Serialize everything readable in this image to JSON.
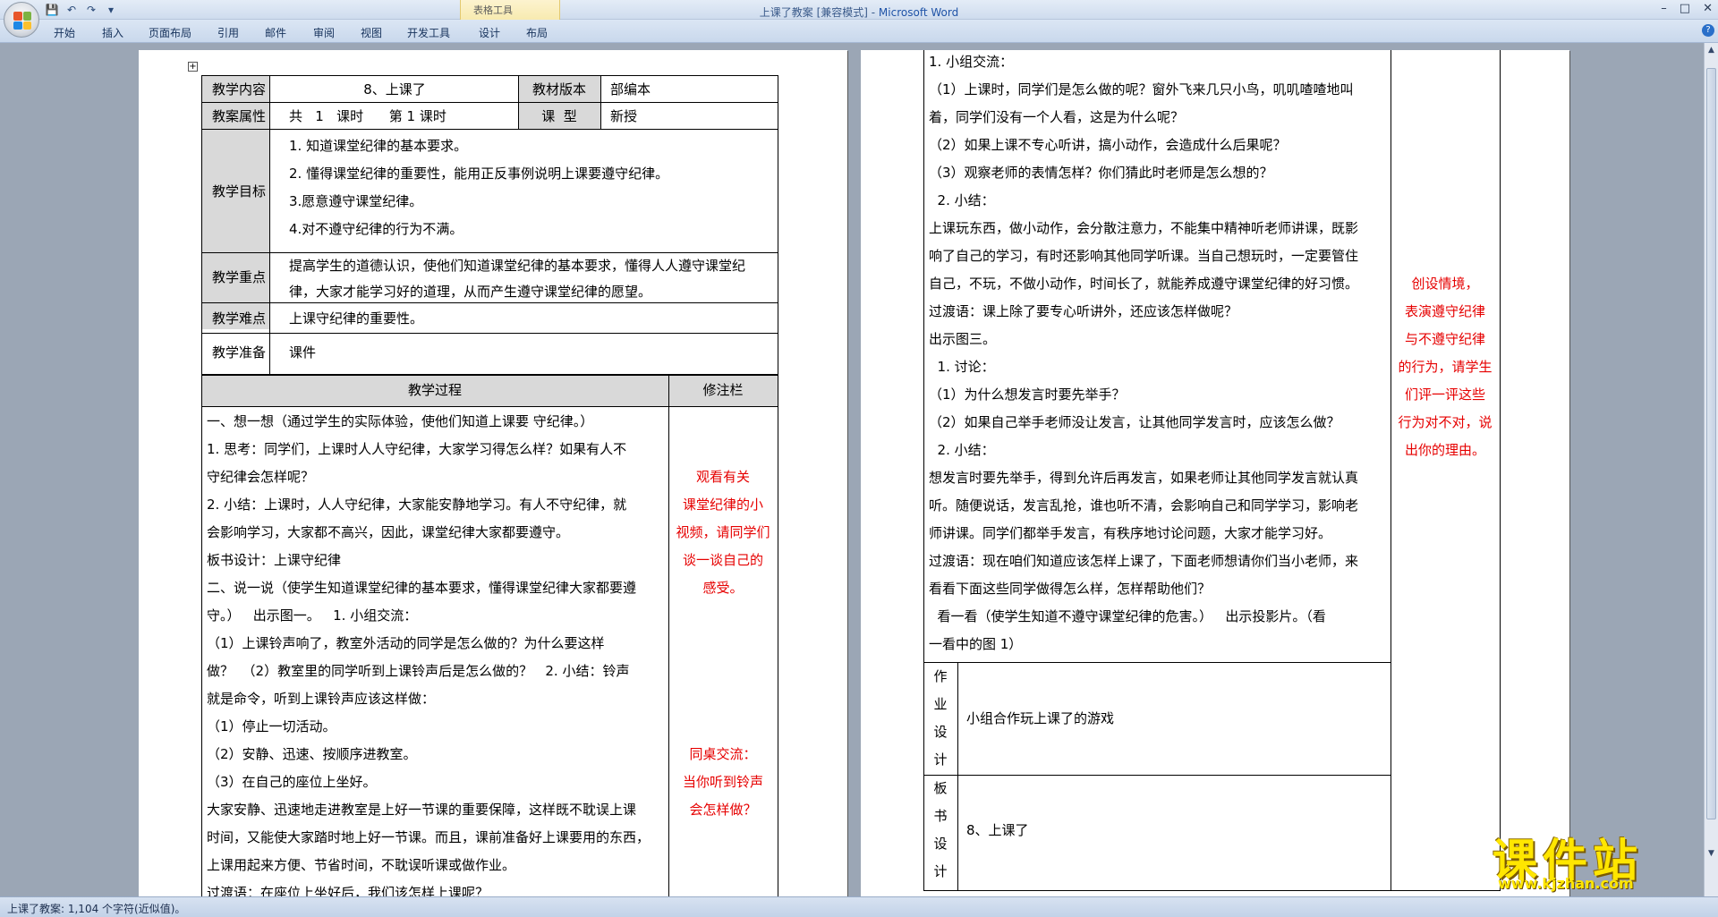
{
  "window": {
    "title_doc": "上课了教案 [兼容模式] - ",
    "title_app": "Microsoft Word",
    "contextual_group": "表格工具"
  },
  "ribbon": {
    "tabs": [
      "开始",
      "插入",
      "页面布局",
      "引用",
      "邮件",
      "审阅",
      "视图",
      "开发工具",
      "设计",
      "布局"
    ]
  },
  "status": {
    "text": "上课了教案: 1,104 个字符(近似值)。"
  },
  "watermark": {
    "main": "课件站",
    "url": "www.kjzhan.com"
  },
  "left": {
    "r1": {
      "lbl1": "教学内容",
      "val1": "8、上课了",
      "lbl2": "教材版本",
      "val2": "部编本"
    },
    "r2": {
      "lbl1": "教案属性",
      "val1": "共   1   课时      第 1 课时",
      "lbl2": "课  型",
      "val2": "新授"
    },
    "goals": {
      "label": "教学目标",
      "items": [
        "1. 知道课堂纪律的基本要求。",
        "2. 懂得课堂纪律的重要性，能用正反事例说明上课要遵守纪律。",
        "3.愿意遵守课堂纪律。",
        "4.对不遵守纪律的行为不满。"
      ]
    },
    "key": {
      "label": "教学重点",
      "lines": [
        "提高学生的道德认识，使他们知道课堂纪律的基本要求，懂得人人遵守课堂纪",
        "律，大家才能学习好的道理，从而产生遵守课堂纪律的愿望。"
      ]
    },
    "difficulty": {
      "label": "教学难点",
      "text": "上课守纪律的重要性。"
    },
    "prep": {
      "label": "教学准备",
      "text": "课件"
    },
    "process_header": {
      "main": "教学过程",
      "notes": "修注栏"
    },
    "process_lines": [
      "一、想一想（通过学生的实际体验，使他们知道上课要   守纪律。）",
      "1. 思考：同学们，上课时人人守纪律，大家学习得怎么样？如果有人不",
      "守纪律会怎样呢？",
      "2. 小结：上课时，人人守纪律，大家能安静地学习。有人不守纪律，就",
      "会影响学习，大家都不高兴，因此，课堂纪律大家都要遵守。",
      "板书设计：上课守纪律",
      "二、说一说（使学生知道课堂纪律的基本要求，懂得课堂纪律大家都要遵",
      "守。）   出示图一。   1. 小组交流：",
      "（1）上课铃声响了，教室外活动的同学是怎么做的？为什么要这样",
      "做？  （2）教室里的同学听到上课铃声后是怎么做的？   2. 小结：铃声",
      "就是命令，听到上课铃声应该这样做：",
      "（1）停止一切活动。",
      "（2）安静、迅速、按顺序进教室。",
      "（3）在自己的座位上坐好。",
      "大家安静、迅速地走进教室是上好一节课的重要保障，这样既不耽误上课",
      "时间，又能使大家踏时地上好一节课。而且，课前准备好上课要用的东西，",
      "上课用起来方便、节省时间，不耽误听课或做作业。",
      "过渡语：在座位上坐好后，我们该怎样上课呢？"
    ],
    "note1": [
      "观看有关",
      "课堂纪律的小",
      "视频，请同学们",
      "谈一谈自己的",
      "感受。"
    ],
    "note2": [
      "同桌交流：",
      "当你听到铃声",
      "会怎样做？"
    ]
  },
  "right": {
    "lines": [
      "1. 小组交流：",
      "（1）上课时，同学们是怎么做的呢？窗外飞来几只小鸟，叽叽喳喳地叫",
      "着，同学们没有一个人看，这是为什么呢？",
      "（2）如果上课不专心听讲，搞小动作，会造成什么后果呢？",
      "（3）观察老师的表情怎样？你们猜此时老师是怎么想的？",
      "  2. 小结：",
      "上课玩东西，做小动作，会分散注意力，不能集中精神听老师讲课，既影",
      "响了自己的学习，有时还影响其他同学听课。当自己想玩时，一定要管住",
      "自己，不玩，不做小动作，时间长了，就能养成遵守课堂纪律的好习惯。",
      "过渡语：课上除了要专心听讲外，还应该怎样做呢？",
      "出示图三。",
      "  1. 讨论：",
      "（1）为什么想发言时要先举手？",
      "（2）如果自己举手老师没让发言，让其他同学发言时，应该怎么做？",
      "  2. 小结：",
      "想发言时要先举手，得到允许后再发言，如果老师让其他同学发言就认真",
      "听。随便说话，发言乱抢，谁也听不清，会影响自己和同学学习，影响老",
      "师讲课。同学们都举手发言，有秩序地讨论问题，大家才能学习好。",
      "过渡语：现在咱们知道应该怎样上课了，下面老师想请你们当小老师，来",
      "看看下面这些同学做得怎么样，怎样帮助他们？",
      "  看一看（使学生知道不遵守课堂纪律的危害。）   出示投影片。（看",
      "一看中的图 1）"
    ],
    "note": [
      "创设情境，",
      "表演遵守纪律",
      "与不遵守纪律",
      "的行为，请学生",
      "们评一评这些",
      "行为对不对，说",
      "出你的理由。"
    ],
    "homework": {
      "label_chars": [
        "作",
        "业",
        "设",
        "计"
      ],
      "text": "小组合作玩上课了的游戏"
    },
    "board": {
      "label_chars": [
        "板",
        "书",
        "设",
        "计"
      ],
      "text": "8、上课了"
    }
  }
}
